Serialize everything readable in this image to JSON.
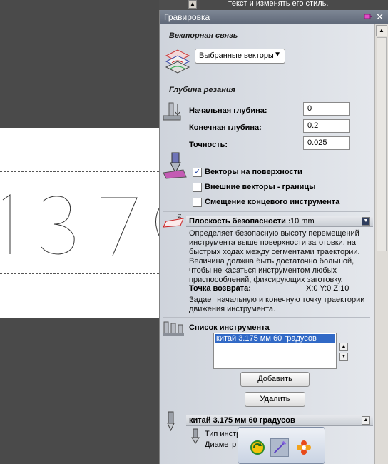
{
  "help_strip": {
    "text": "текст и изменять его стиль."
  },
  "canvas": {
    "digits": "137",
    "partial_digit": "("
  },
  "panel": {
    "title": "Гравировка",
    "close_label": "✕",
    "vector_section": {
      "title": "Векторная связь",
      "dropdown_value": "Выбранные векторы"
    },
    "depth_section": {
      "title": "Глубина резания",
      "start_depth_label": "Начальная глубина:",
      "start_depth_value": "0",
      "end_depth_label": "Конечная глубина:",
      "end_depth_value": "0.2",
      "tolerance_label": "Точность:",
      "tolerance_value": "0.025",
      "cb_surface_label": "Векторы на поверхности",
      "cb_surface_checked": true,
      "cb_boundary_label": "Внешние векторы - границы",
      "cb_boundary_checked": false,
      "cb_offset_label": "Смещение концевого инструмента",
      "cb_offset_checked": false
    },
    "safe_z": {
      "title": "Плоскость безопасности :",
      "value": "10 mm",
      "icon_caption": "-Z",
      "description": "Определяет безопасную высоту перемещений инструмента выше поверхности заготовки, на быстрых ходах между сегментами траектории. Величина должна быть достаточно большой, чтобы не касаться инструментом любых приспособлений, фиксирующих заготовку.",
      "home_label": "Точка возврата:",
      "home_value": "X:0 Y:0 Z:10",
      "home_description": "Задает начальную и конечную точку траектории движения инструмента."
    },
    "tool_list": {
      "title": "Список инструмента",
      "items": [
        "китай 3.175 мм 60 градусов"
      ],
      "add_label": "Добавить",
      "delete_label": "Удалить"
    },
    "tool_detail": {
      "title": "китай 3.175 мм 60 градусов",
      "type_label": "Тип инструмента: V-Образный",
      "diameter_label": "Диаметр"
    }
  },
  "colors": {
    "title_bar": "#6b7486",
    "selection": "#3169c6",
    "panel_bg": "#d9dde3"
  }
}
